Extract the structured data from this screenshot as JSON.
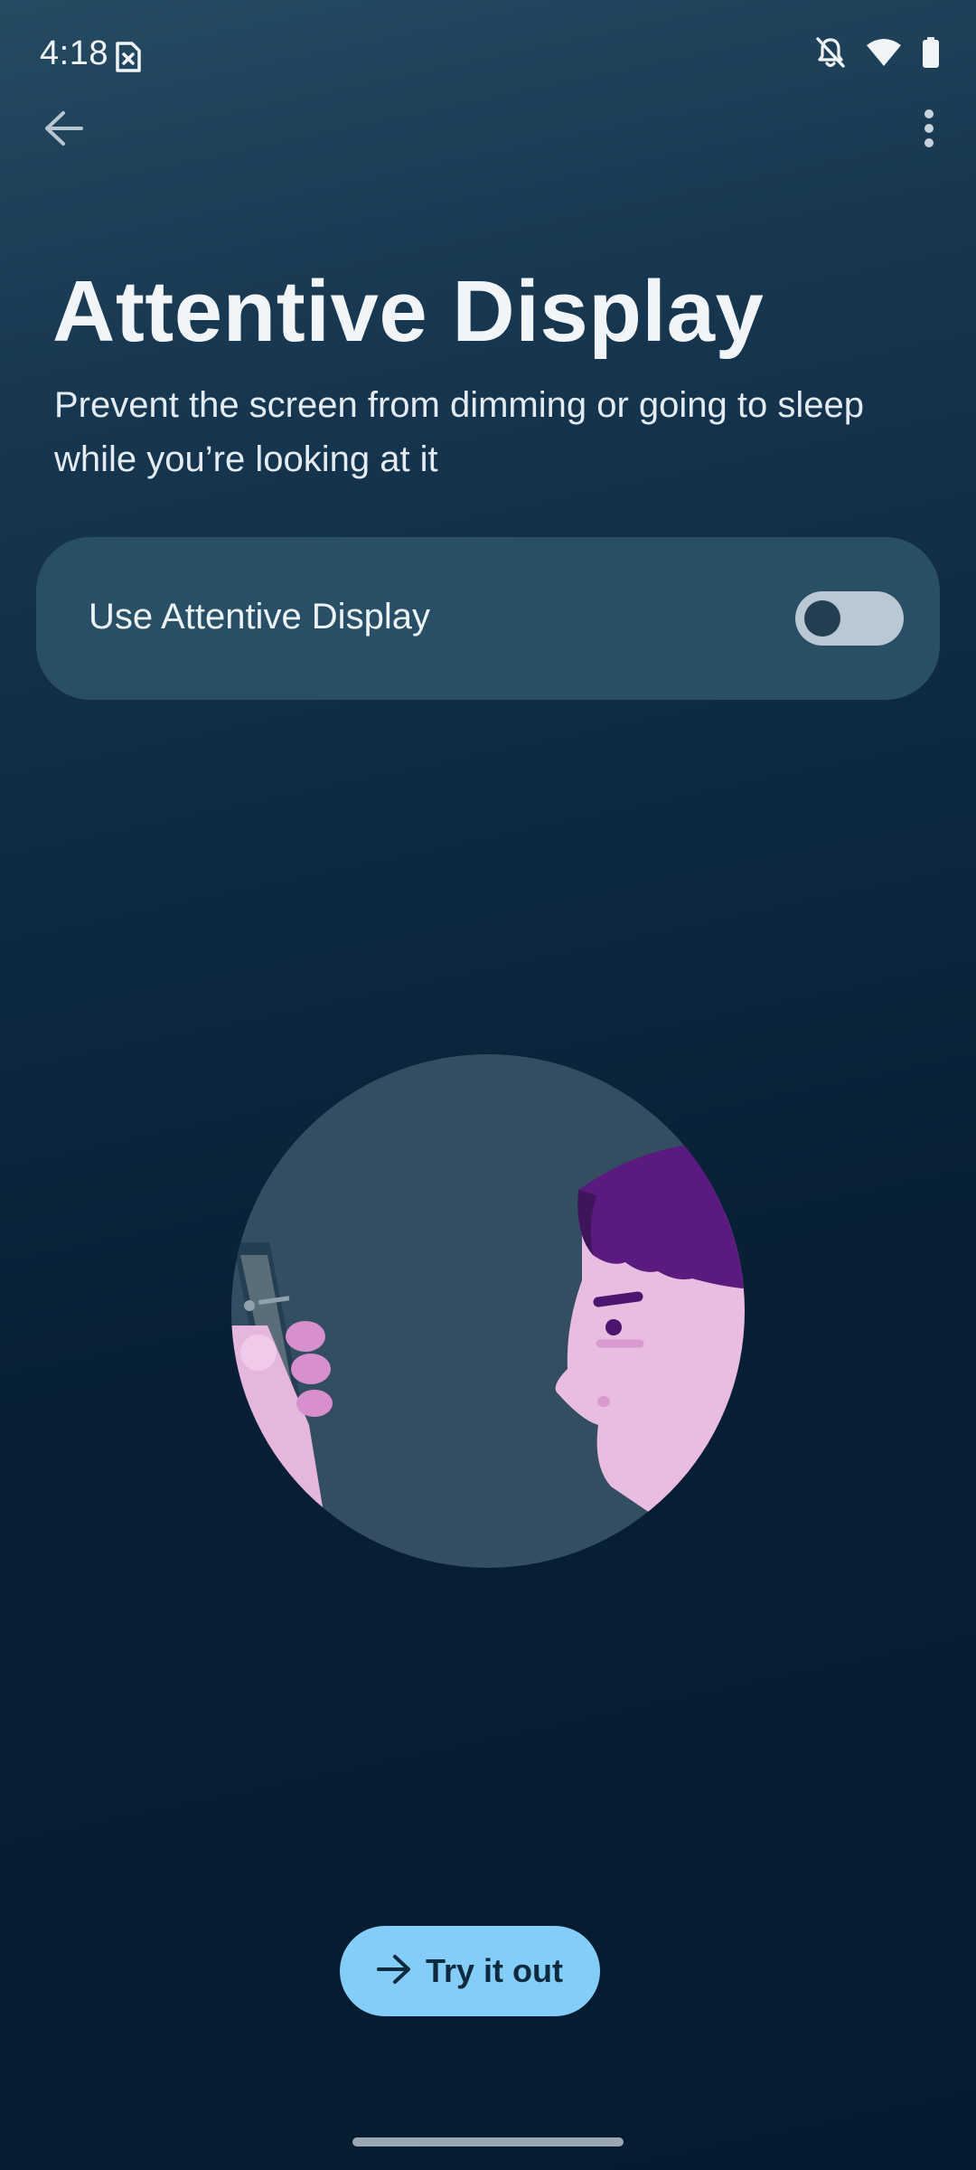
{
  "status_bar": {
    "time": "4:18",
    "icons": [
      "no-sim-icon",
      "notifications-off-icon",
      "wifi-icon",
      "battery-icon"
    ]
  },
  "toolbar": {
    "back_icon": "arrow-back-icon",
    "more_icon": "more-vert-icon"
  },
  "page": {
    "title": "Attentive Display",
    "subtitle": "Prevent the screen from dimming or going to sleep while you’re looking at it"
  },
  "toggle": {
    "label": "Use Attentive Display",
    "state": "off"
  },
  "cta": {
    "label": "Try it out",
    "icon": "arrow-forward-icon"
  },
  "colors": {
    "background_top": "#254b63",
    "background_bottom": "#051b30",
    "card": "#284f66",
    "button": "#84cdf8",
    "switch_track": "#b9c8d3",
    "hair": "#5a1a80",
    "skin": "#e8bde0"
  }
}
